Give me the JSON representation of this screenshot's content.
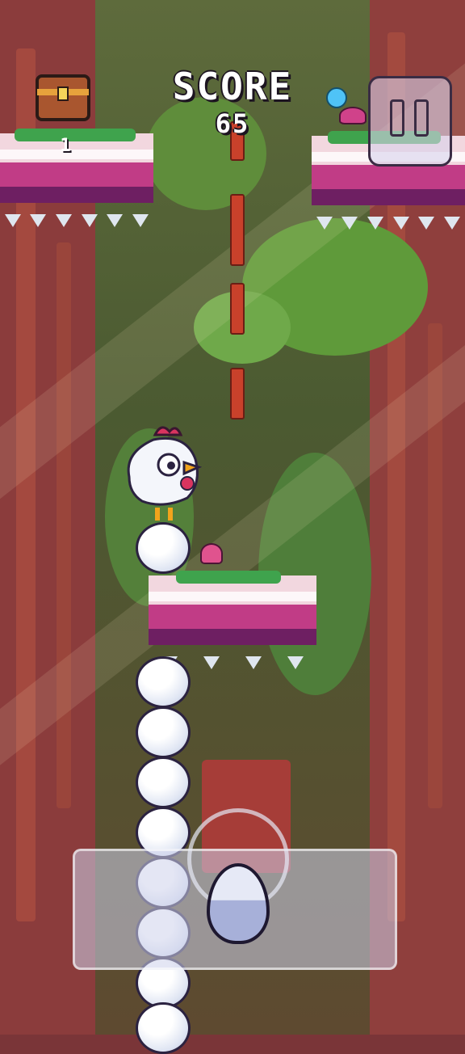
{
  "hud": {
    "score_label": "SCORE",
    "score_value": "65",
    "chest_count": "1"
  },
  "icons": {
    "chest": "treasure-chest-icon",
    "pause": "pause-icon",
    "egg_button": "egg-icon"
  },
  "colors": {
    "platform_pink": "#c13c86",
    "platform_light": "#f2d7df",
    "platform_dark": "#6e1f62",
    "grass": "#3fa34d",
    "background_wood": "#8b3c3c"
  }
}
